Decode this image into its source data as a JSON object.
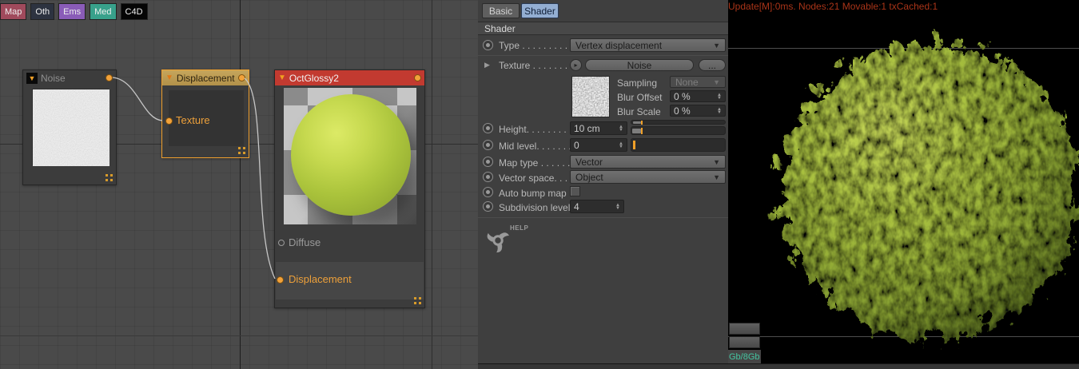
{
  "node_editor": {
    "tabs": [
      {
        "label": "Map",
        "color": "#a04a5c"
      },
      {
        "label": "Oth",
        "color": "#2d3340"
      },
      {
        "label": "Ems",
        "color": "#8a5cb8"
      },
      {
        "label": "Med",
        "color": "#38a18b"
      },
      {
        "label": "C4D",
        "color": "#050505"
      }
    ],
    "noise_node": {
      "title": "Noise"
    },
    "displacement_node": {
      "title": "Displacement",
      "texture_port": "Texture"
    },
    "octglossy_node": {
      "title": "OctGlossy2",
      "diffuse_port": "Diffuse",
      "displacement_port": "Displacement"
    }
  },
  "properties_panel": {
    "tabs": [
      {
        "label": "Basic"
      },
      {
        "label": "Shader"
      }
    ],
    "active_tab": "Shader",
    "section_title": "Shader",
    "type_row": {
      "label": "Type . . . . . . . . . .",
      "value": "Vertex displacement"
    },
    "texture_row": {
      "label": "Texture . . . . . . . .",
      "value": "Noise",
      "browse": "...",
      "arrow": "▸"
    },
    "sampling_row": {
      "label": "Sampling",
      "value": "None"
    },
    "blur_offset_row": {
      "label": "Blur Offset",
      "value": "0 %"
    },
    "blur_scale_row": {
      "label": "Blur Scale",
      "value": "0 %"
    },
    "height_row": {
      "label": "Height. . . . . . . . .",
      "value": "10 cm"
    },
    "mid_level_row": {
      "label": "Mid level. . . . . . .",
      "value": "0"
    },
    "map_type_row": {
      "label": "Map type . . . . . .",
      "value": "Vector"
    },
    "vector_space_row": {
      "label": "Vector space. . . .",
      "value": "Object"
    },
    "auto_bump_row": {
      "label": "Auto bump map",
      "checked": false
    },
    "subdivision_row": {
      "label": "Subdivision level",
      "value": "4"
    },
    "help_label": "HELP"
  },
  "render_view": {
    "status_text": "Update[M]:0ms. Nodes:21 Movable:1 txCached:1",
    "memory_text": "Gb/8Gb",
    "sphere_color": "#a7bf3e",
    "background": "#000000"
  },
  "colors": {
    "accent_orange": "#efa02d",
    "material_red": "#c23a30",
    "selected_tab_blue": "#93aed2",
    "status_text_red": "#a93418",
    "memory_teal": "#45c4a0"
  }
}
